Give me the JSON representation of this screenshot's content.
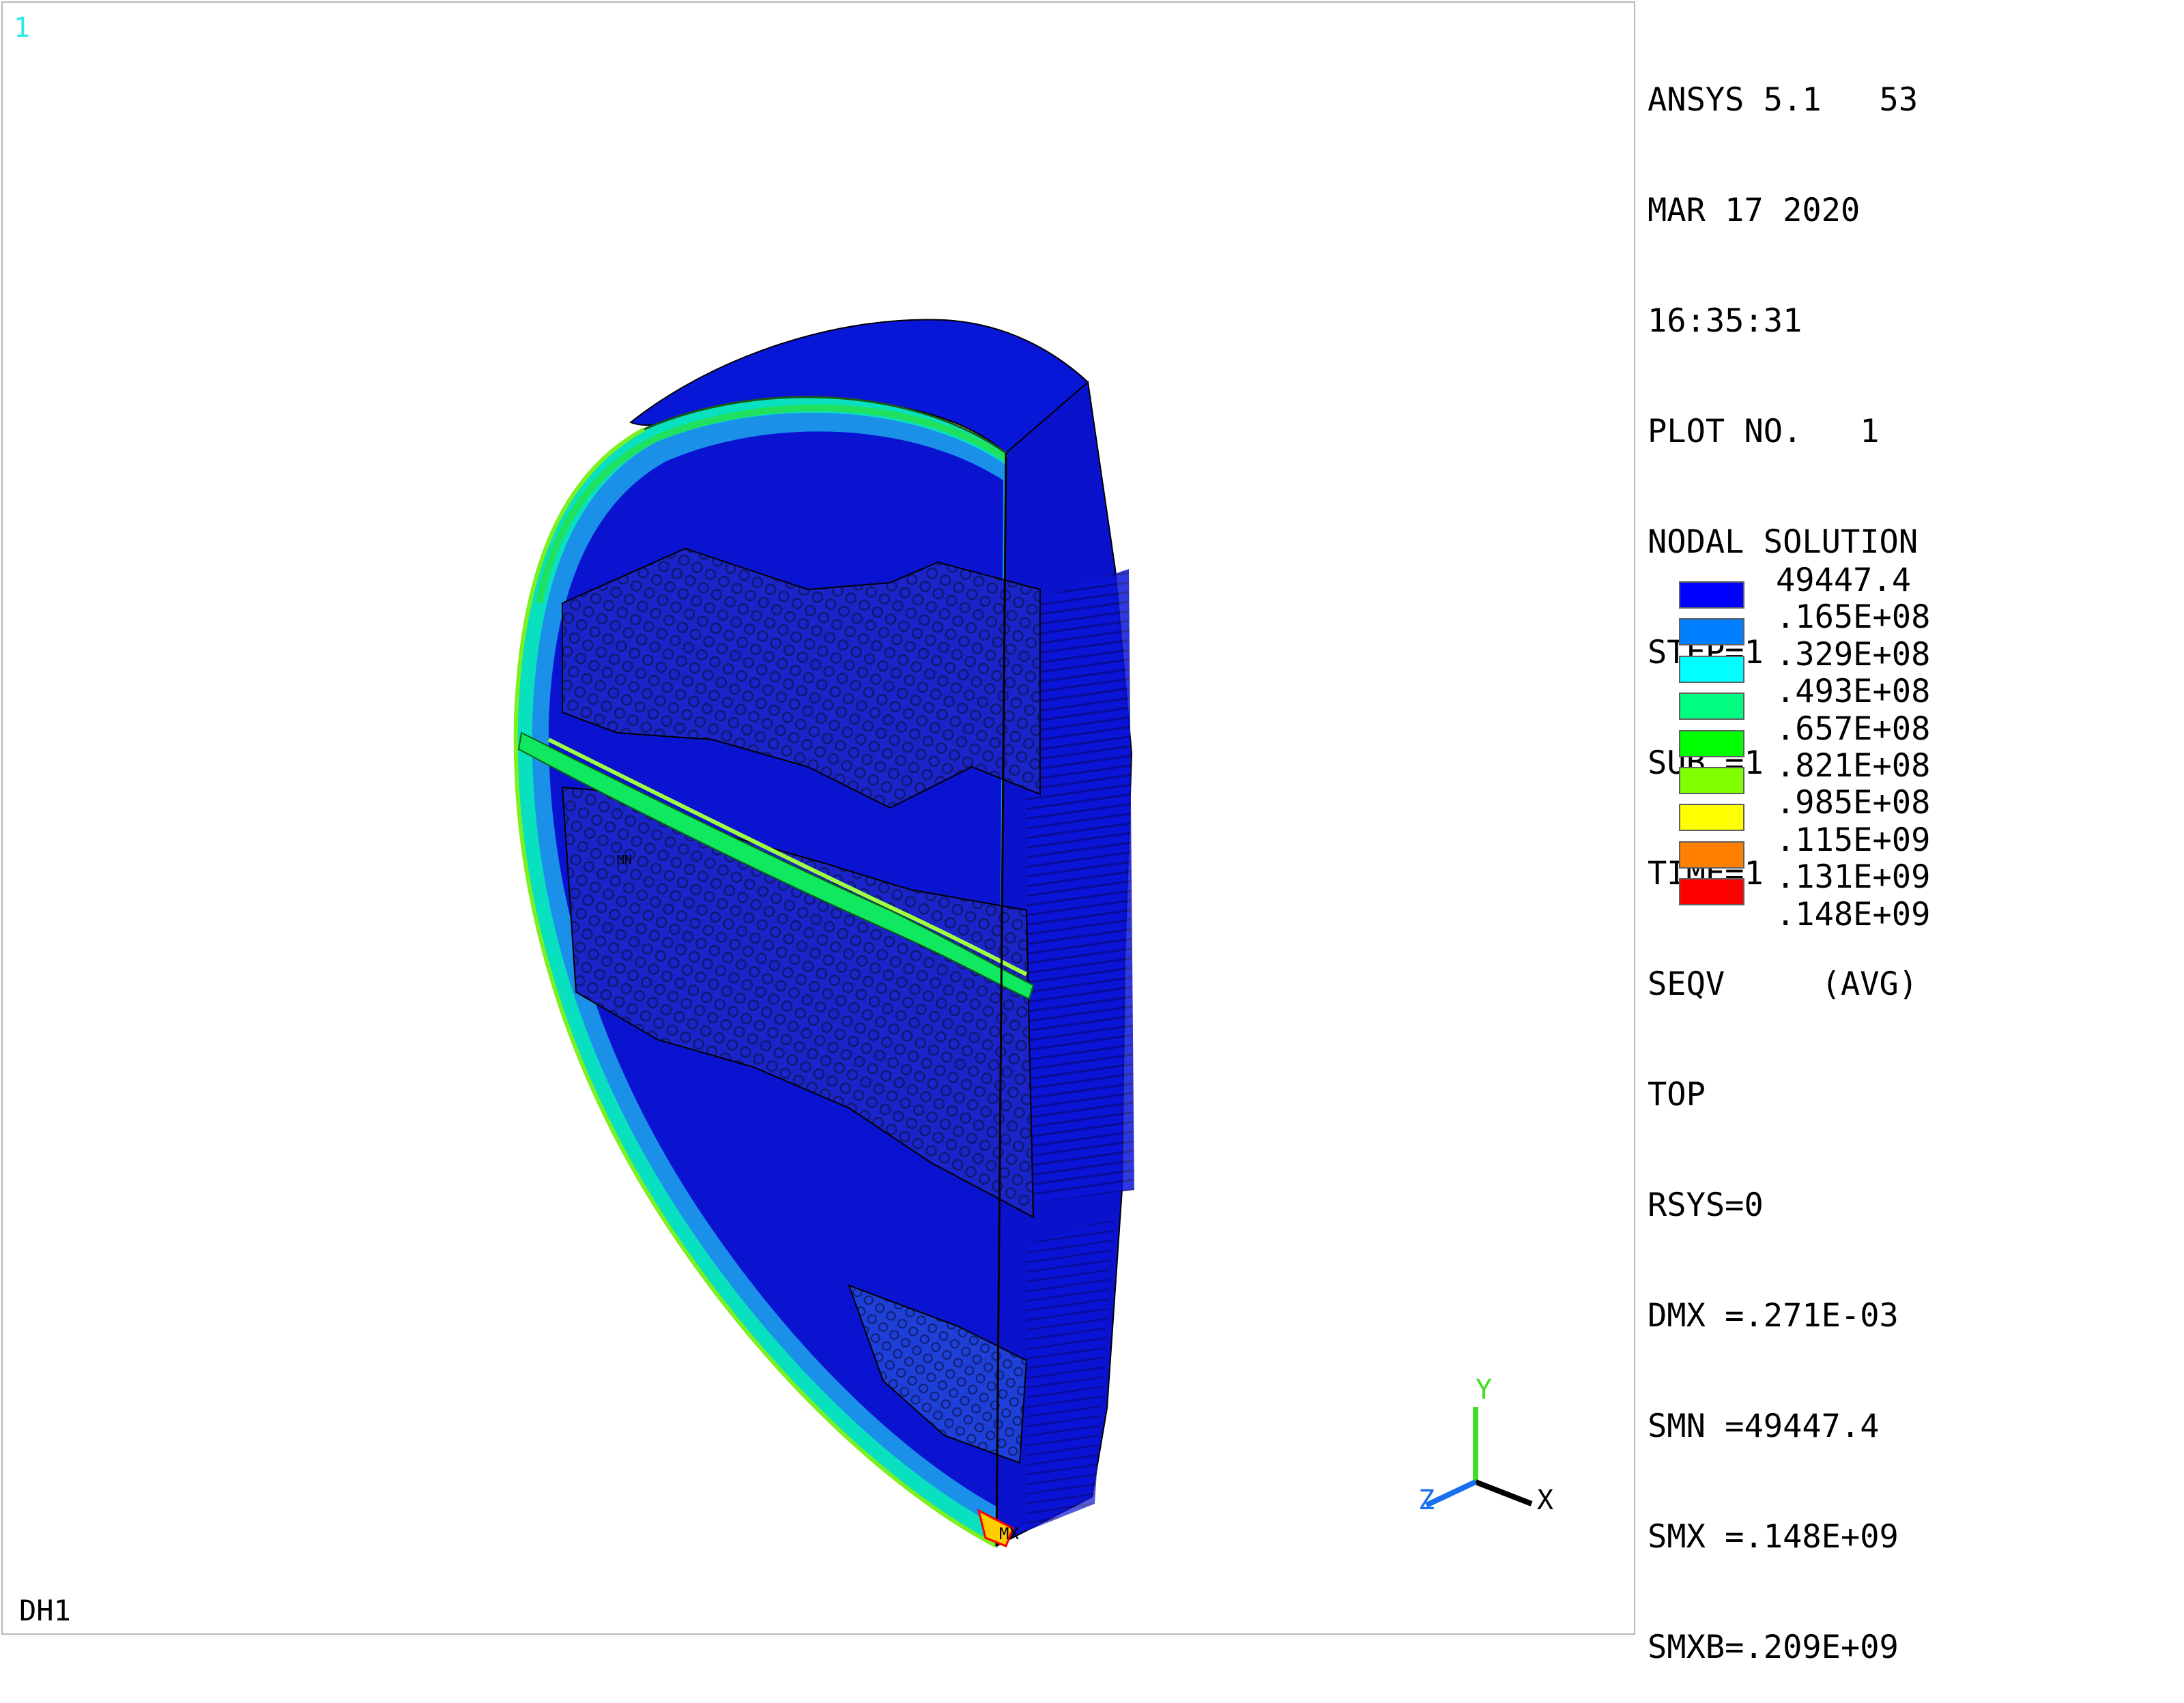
{
  "window": {
    "number": "1",
    "label": "DH1"
  },
  "info_lines": [
    "ANSYS 5.1   53",
    "MAR 17 2020",
    "16:35:31",
    "PLOT NO.   1",
    "NODAL SOLUTION",
    "STEP=1",
    "SUB =1",
    "TIME=1",
    "SEQV     (AVG)",
    "TOP",
    "RSYS=0",
    "DMX =.271E-03",
    "SMN =49447.4",
    "SMX =.148E+09",
    "SMXB=.209E+09"
  ],
  "legend": {
    "values": [
      "49447.4",
      ".165E+08",
      ".329E+08",
      ".493E+08",
      ".657E+08",
      ".821E+08",
      ".985E+08",
      ".115E+09",
      ".131E+09",
      ".148E+09"
    ],
    "colors": [
      "#0000ff",
      "#0080ff",
      "#00ffff",
      "#00ff80",
      "#00ff00",
      "#80ff00",
      "#ffff00",
      "#ff8000",
      "#ff0000"
    ]
  },
  "triad": {
    "x": "X",
    "y": "Y",
    "z": "Z"
  },
  "markers": {
    "max": "MX",
    "min": "MN"
  }
}
